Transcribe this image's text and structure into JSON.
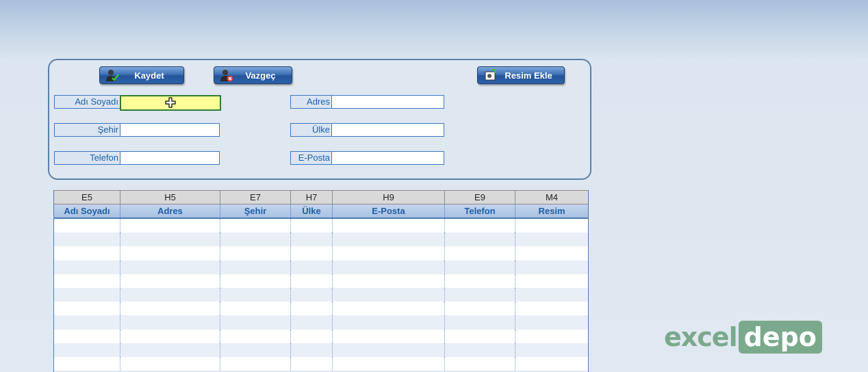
{
  "toolbar": {
    "save_label": "Kaydet",
    "cancel_label": "Vazgeç",
    "add_image_label": "Resim Ekle"
  },
  "form": {
    "name_label": "Adı Soyadı",
    "city_label": "Şehir",
    "phone_label": "Telefon",
    "address_label": "Adres",
    "country_label": "Ülke",
    "email_label": "E-Posta",
    "name_value": "",
    "city_value": "",
    "phone_value": "",
    "address_value": "",
    "country_value": "",
    "email_value": ""
  },
  "table": {
    "cell_refs": [
      "E5",
      "H5",
      "E7",
      "H7",
      "H9",
      "E9",
      "M4"
    ],
    "headers": [
      "Adı Soyadı",
      "Adres",
      "Şehir",
      "Ülke",
      "E-Posta",
      "Telefon",
      "Resim"
    ],
    "rows": []
  },
  "logo": {
    "part1": "excel",
    "part2": "depo"
  },
  "colors": {
    "accent": "#1d5fa8",
    "active_cell": "#ffff99",
    "logo_green": "#7aa98c"
  }
}
